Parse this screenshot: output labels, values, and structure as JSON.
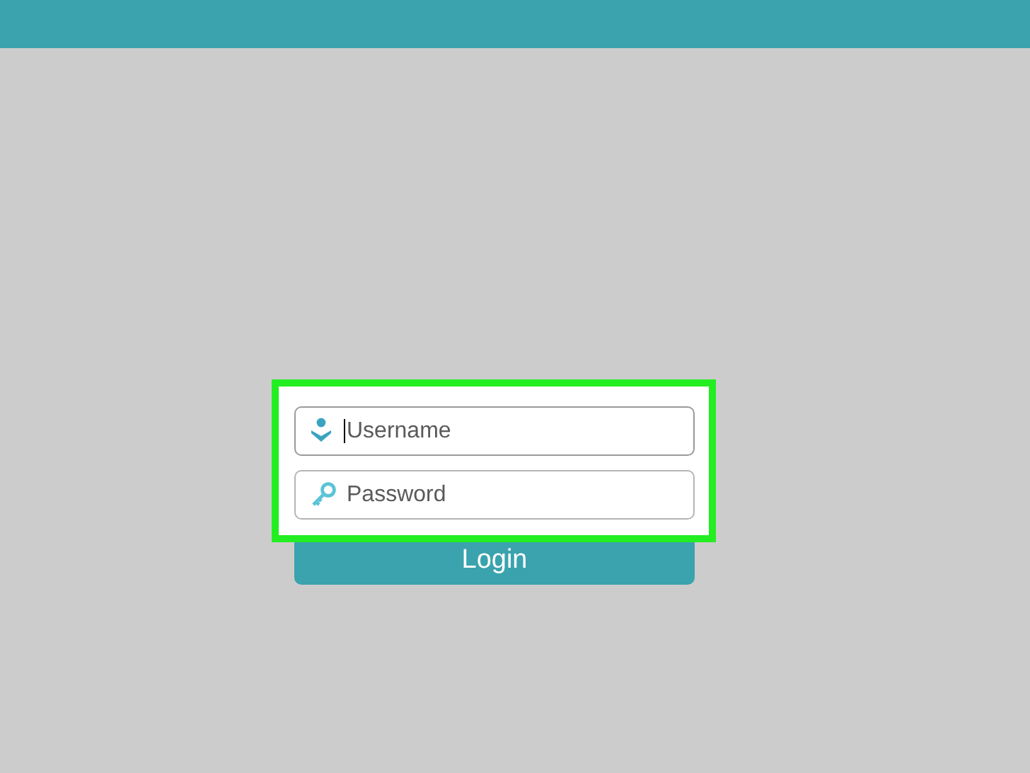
{
  "fields": [
    {
      "kind": "user",
      "placeholder": "Username",
      "focused": true
    },
    {
      "kind": "key",
      "placeholder": "Password",
      "focused": false
    }
  ],
  "login_button": {
    "label": "Login"
  },
  "highlight": {
    "on": true
  }
}
